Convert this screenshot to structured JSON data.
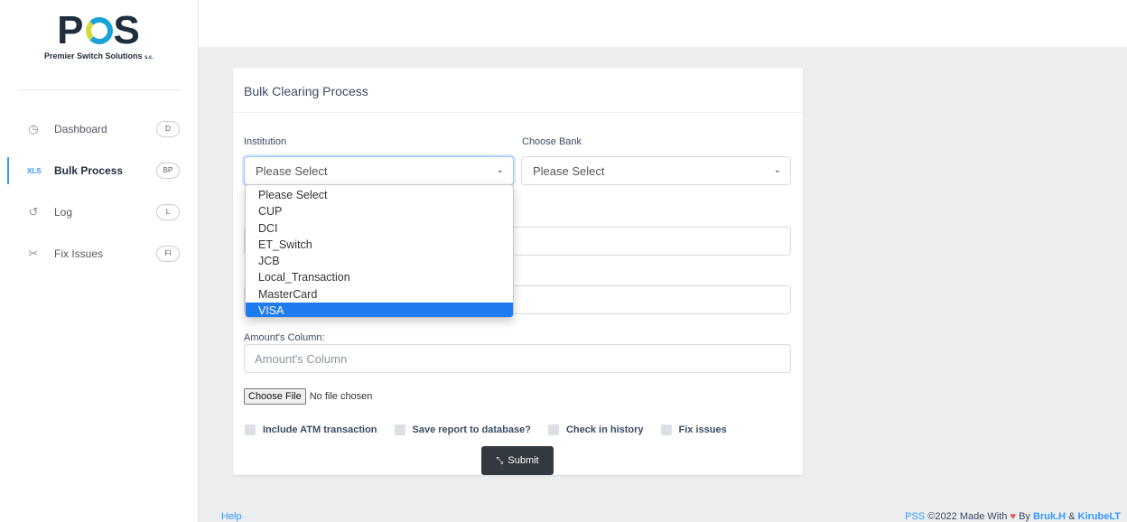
{
  "logo": {
    "mark_left": "P",
    "mark_right": "S",
    "tagline": "Premier Switch Solutions",
    "tagline_suffix": "s.c."
  },
  "sidebar": {
    "items": [
      {
        "label": "Dashboard",
        "badge": "D",
        "icon": "clock-icon"
      },
      {
        "label": "Bulk Process",
        "badge": "BP",
        "icon": "xls-icon",
        "icon_text": "XLS"
      },
      {
        "label": "Log",
        "badge": "L",
        "icon": "history-icon"
      },
      {
        "label": "Fix Issues",
        "badge": "FI",
        "icon": "scissors-icon"
      }
    ],
    "active_index": 1
  },
  "card": {
    "title": "Bulk Clearing Process",
    "institution": {
      "label": "Institution",
      "value": "Please Select"
    },
    "bank": {
      "label": "Choose Bank",
      "value": "Please Select"
    },
    "amount": {
      "label": "Amount's Column:",
      "placeholder": "Amount's Column"
    },
    "file": {
      "button": "Choose File",
      "status": "No file chosen"
    },
    "checkboxes": [
      "Include ATM transaction",
      "Save report to database?",
      "Check in history",
      "Fix issues"
    ],
    "submit_label": "Submit"
  },
  "dropdown": {
    "options": [
      "Please Select",
      "CUP",
      "DCI",
      "ET_Switch",
      "JCB",
      "Local_Transaction",
      "MasterCard",
      "VISA"
    ],
    "highlighted": "VISA"
  },
  "footer": {
    "help": "Help",
    "brand": "PSS",
    "copyright": "©2022 Made With",
    "by": "By",
    "author1": "Bruk.H",
    "amp": "&",
    "author2": "KirubeLT"
  },
  "colors": {
    "accent": "#3399ff",
    "highlight": "#1e7bf0",
    "submit_bg": "#333940",
    "heart": "#e55353"
  }
}
